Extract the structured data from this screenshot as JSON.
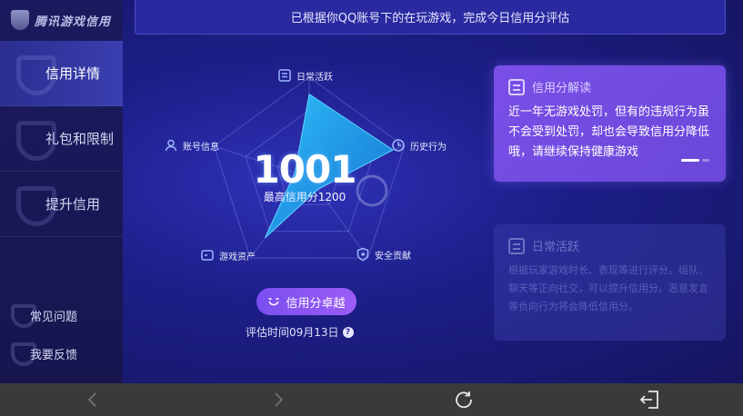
{
  "app": {
    "logo_text": "腾讯游戏信用"
  },
  "sidebar": {
    "items": [
      {
        "label": "信用详情",
        "active": true
      },
      {
        "label": "礼包和限制",
        "active": false
      },
      {
        "label": "提升信用",
        "active": false
      }
    ],
    "links": [
      {
        "label": "常见问题"
      },
      {
        "label": "我要反馈"
      }
    ]
  },
  "banner": {
    "text": "已根据你QQ账号下的在玩游戏，完成今日信用分评估"
  },
  "radar": {
    "score": "1001",
    "max_label": "最高信用分1200",
    "axes": [
      {
        "label": "日常活跃",
        "icon": "doc-icon"
      },
      {
        "label": "历史行为",
        "icon": "clock-icon"
      },
      {
        "label": "安全贡献",
        "icon": "shield-icon"
      },
      {
        "label": "游戏资产",
        "icon": "asset-icon"
      },
      {
        "label": "账号信息",
        "icon": "user-icon"
      }
    ],
    "values": [
      0.83,
      0.88,
      0.15,
      0.75,
      0.15
    ],
    "level": "信用分卓越",
    "eval_time": "评估时间09月13日"
  },
  "cards": {
    "active": {
      "title": "信用分解读",
      "body": "近一年无游戏处罚，但有的违规行为虽不会受到处罚，却也会导致信用分降低哦，请继续保持健康游戏"
    },
    "dim": {
      "title": "日常活跃",
      "body": "根据玩家游戏时长、表现等进行评分。组队、聊天等正向社交，可以提升信用分。恶意发言等负向行为将会降低信用分。"
    }
  },
  "colors": {
    "accent": "#7a4ff0",
    "radar_fill": "#1aa6e8",
    "background": "#1d1f8a"
  },
  "system_bar": {
    "buttons": [
      "back-icon",
      "forward-icon",
      "refresh-icon",
      "exit-icon"
    ]
  }
}
